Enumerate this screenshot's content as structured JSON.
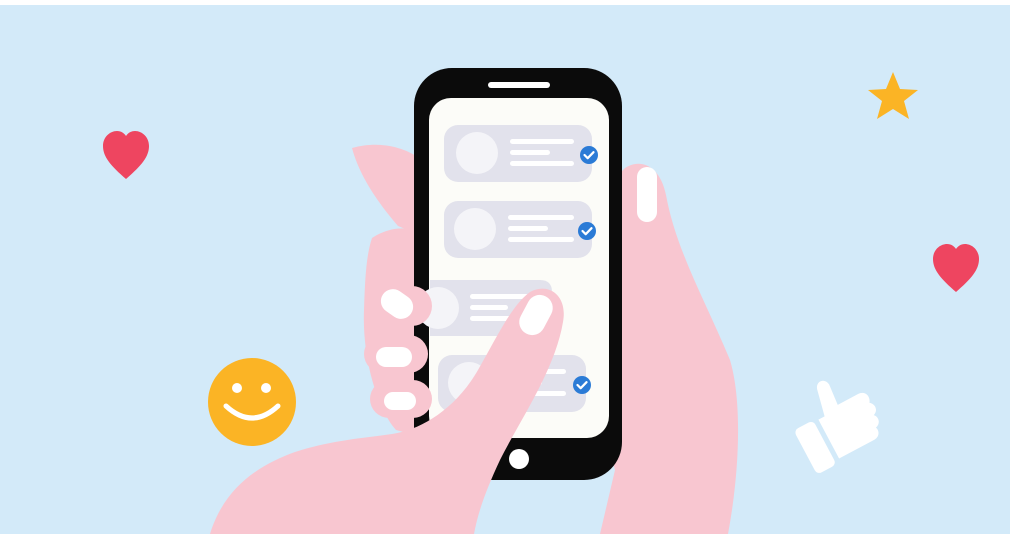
{
  "illustration": {
    "subject": "hands-holding-smartphone-with-checked-list",
    "background_color": "#D3EAF9",
    "palette": {
      "skin": "#F8C6D0",
      "nails": "#FFFFFF",
      "phone_body": "#0B0B0B",
      "screen": "#FCFCF8",
      "card": "#E2E2EC",
      "card_lines": "#FFFFFF",
      "check_badge": "#2B7BD6",
      "heart": "#EE4560",
      "star": "#FBB425",
      "smiley": "#FBB425",
      "thumbs_up": "#FFFFFF"
    },
    "icons": [
      "heart-icon",
      "heart-icon",
      "star-icon",
      "smiley-icon",
      "thumbs-up-icon",
      "check-icon"
    ],
    "list_cards": [
      {
        "checked": true
      },
      {
        "checked": true
      },
      {
        "checked": false
      },
      {
        "checked": true
      }
    ]
  }
}
